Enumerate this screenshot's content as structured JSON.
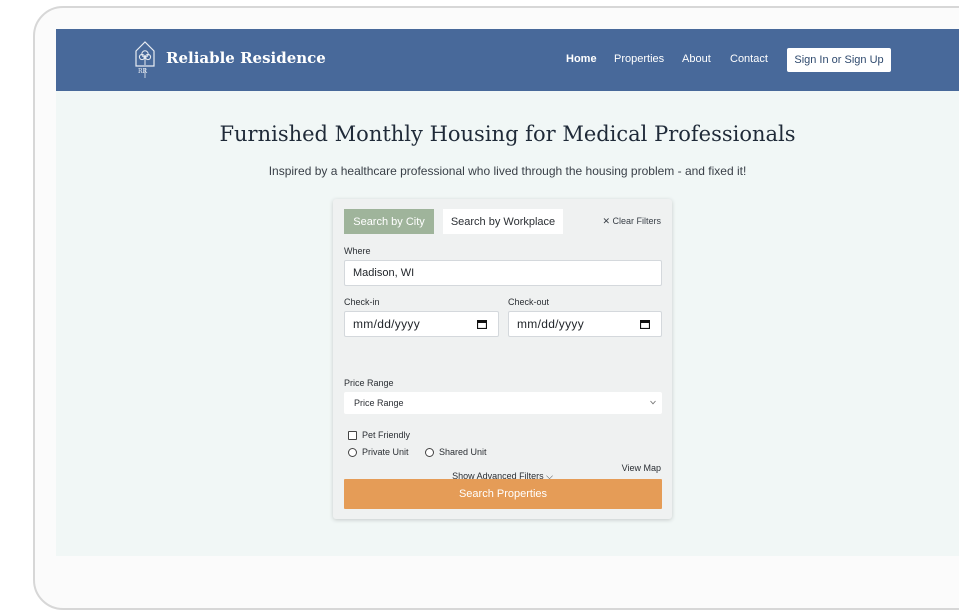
{
  "brand": {
    "name": "Reliable Residence",
    "logo_monogram": "RR",
    "logo_icon": "house-tree-icon"
  },
  "nav": {
    "links": [
      "Home",
      "Properties",
      "About",
      "Contact"
    ],
    "active": "Home",
    "signin_label": "Sign In or Sign Up"
  },
  "hero": {
    "title": "Furnished Monthly Housing for Medical Professionals",
    "subtitle": "Inspired by a healthcare professional who lived through the housing problem - and fixed it!"
  },
  "search": {
    "tabs": [
      "Search by City",
      "Search by Workplace"
    ],
    "active_tab": "Search by City",
    "clear_label": "✕ Clear Filters",
    "where_label": "Where",
    "where_value": "Madison, WI",
    "checkin_label": "Check-in",
    "checkout_label": "Check-out",
    "date_placeholder": "mm/dd/yyyy",
    "price_label": "Price Range",
    "price_selected": "Price Range",
    "pet_label": "Pet Friendly",
    "private_label": "Private Unit",
    "shared_label": "Shared Unit",
    "advanced_label": "Show Advanced Filters ⌵",
    "view_map_label": "View Map",
    "button_label": "Search Properties"
  },
  "colors": {
    "navbar": "#48699a",
    "page_bg": "#f1f7f6",
    "active_tab": "#9fb49b",
    "search_button": "#e59c57"
  }
}
